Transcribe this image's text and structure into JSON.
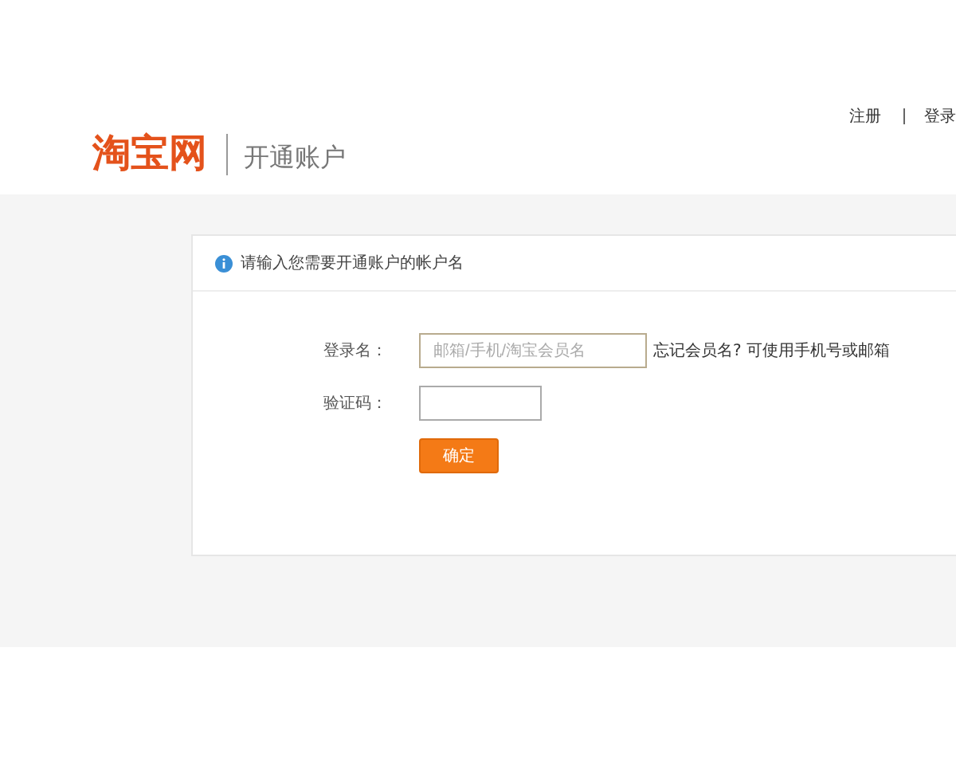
{
  "header": {
    "logo": "淘宝网",
    "subtitle": "开通账户",
    "links": [
      "注册",
      "登录"
    ]
  },
  "card": {
    "notice": "请输入您需要开通账户的帐户名",
    "fields": [
      {
        "label": "登录名：",
        "placeholder": "邮箱/手机/淘宝会员名",
        "hint": "忘记会员名? 可使用手机号或邮箱",
        "kind": "wide"
      },
      {
        "label": "验证码：",
        "kind": "short"
      }
    ],
    "submit": "确定"
  }
}
